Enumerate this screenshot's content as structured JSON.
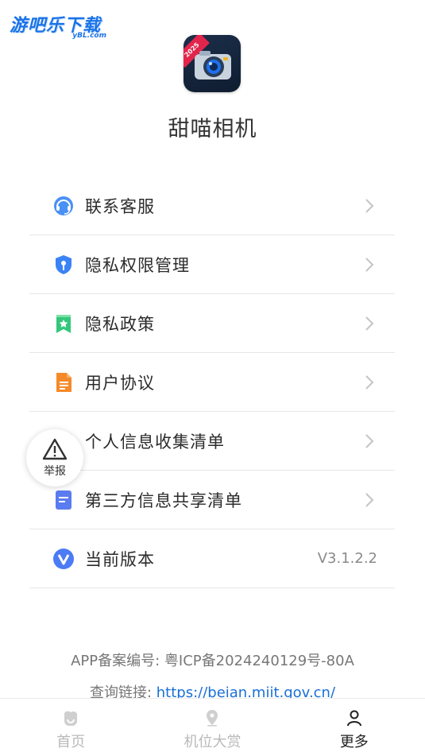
{
  "watermark": {
    "text": "游吧乐下载",
    "sub": "yBL.com"
  },
  "app": {
    "badge": "2025",
    "title": "甜喵相机"
  },
  "menu": [
    {
      "label": "联系客服",
      "icon": "headset-icon"
    },
    {
      "label": "隐私权限管理",
      "icon": "shield-key-icon"
    },
    {
      "label": "隐私政策",
      "icon": "bookmark-star-icon"
    },
    {
      "label": "用户协议",
      "icon": "document-icon"
    },
    {
      "label": "个人信息收集清单",
      "icon": "person-card-icon"
    },
    {
      "label": "第三方信息共享清单",
      "icon": "list-icon"
    },
    {
      "label": "当前版本",
      "icon": "version-v-icon",
      "value": "V3.1.2.2"
    }
  ],
  "report": {
    "label": "举报"
  },
  "footer": {
    "icp_label": "APP备案编号: 粤ICP备2024240129号-80A",
    "link_label": "查询链接: ",
    "link_url": "https://beian.miit.gov.cn/"
  },
  "tabs": [
    {
      "label": "首页",
      "icon": "home-icon",
      "active": false
    },
    {
      "label": "机位大赏",
      "icon": "location-pin-icon",
      "active": false
    },
    {
      "label": "更多",
      "icon": "person-icon",
      "active": true
    }
  ],
  "colors": {
    "accent": "#1a6fd6",
    "text": "#2b2b2b",
    "muted": "#b9b9b9"
  }
}
